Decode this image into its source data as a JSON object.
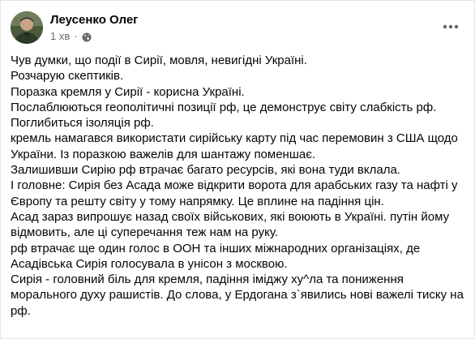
{
  "post": {
    "author": "Леусенко Олег",
    "time": "1 хв",
    "separator": "·",
    "privacy_icon": "globe-icon",
    "more_icon": "more-horizontal-icon",
    "lines": [
      "Чув думки, що події в Сирії, мовля, невигідні Україні.",
      "Розчарую скептиків.",
      "Поразка кремля у Сирії - корисна Україні.",
      "Послаблюються геополітичні позиції рф, це демонструє світу слабкість рф.",
      "Поглибиться ізоляція рф.",
      "кремль намагався використати сирійську карту під час перемовин з США щодо",
      "України. Із поразкою важелів для шантажу поменшає.",
      "Залишивши Сирію рф втрачає багато ресурсів, які вона туди вклала.",
      "І головне: Сирія без Асада може відкрити ворота для арабських газу та нафті у",
      "Європу та решту світу у тому напрямку. Це вплине на падіння цін.",
      "Асад зараз випрошує назад своїх військових, які воюють в Україні. путін йому",
      "відмовить, але ці суперечання теж нам на руку.",
      "рф втрачає ще один голос в ООН та інших міжнародних організаціях, де",
      "Асадівська Сирія голосувала в унісон з москвою.",
      "Сирія - головний біль для кремля, падіння іміджу ху^ла та пониження",
      "морального духу рашистів. До слова, у Ердогана з`явились нові важелі тиску на",
      "рф."
    ]
  },
  "colors": {
    "text_primary": "#050505",
    "text_secondary": "#65676b",
    "card_border": "#e4e6eb"
  }
}
